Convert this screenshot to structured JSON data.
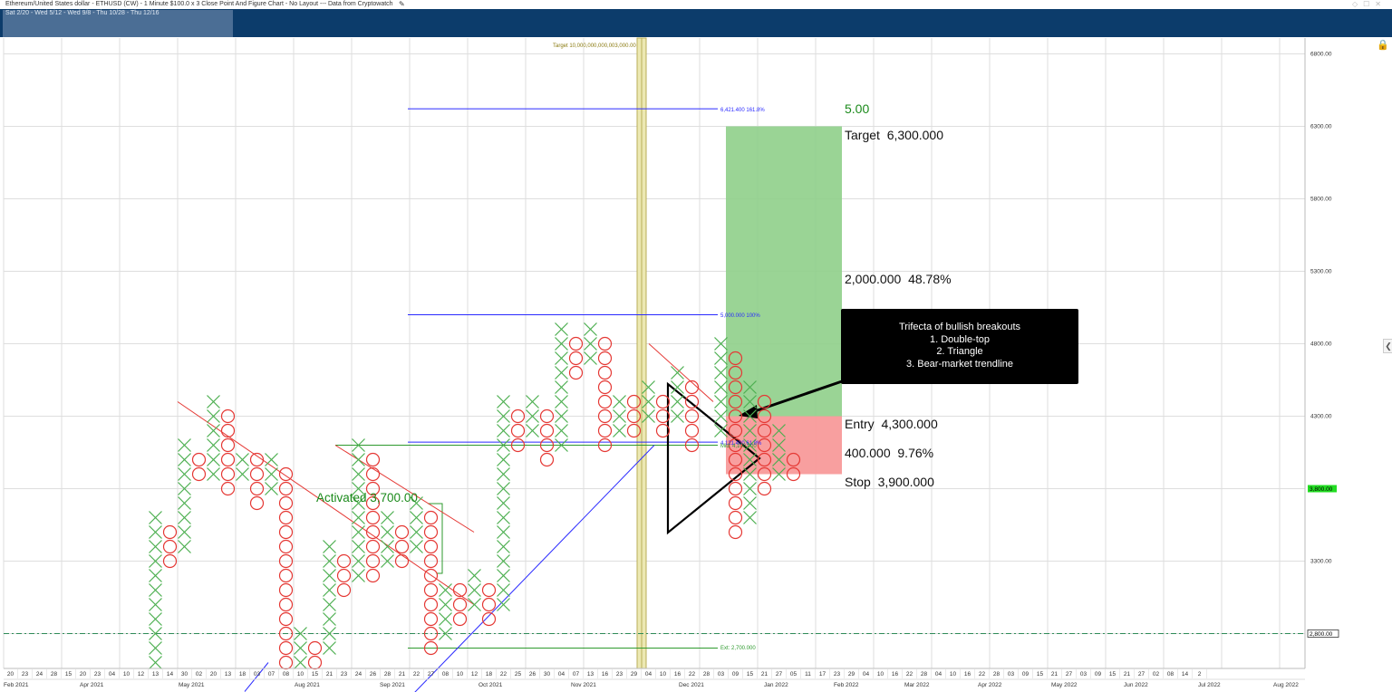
{
  "window": {
    "title": "Ethereum/United States dollar - ETHUSD (CW) - 1 Minute $100.0 x 3 Close Point And Figure Chart - No Layout --- Data from Cryptowatch",
    "navigator_label": "Sat 2/20 - Wed 5/12 - Wed 9/8 - Thu 10/28 - Thu 12/16"
  },
  "colors": {
    "x_box": "#4caf50",
    "o_box": "#e53935",
    "nav_bg": "#0c3c6b",
    "target_zone": "#8fcf8a",
    "stop_zone": "#f89a9a",
    "price_badge": "#22dd22"
  },
  "chart_data": {
    "type": "point-and-figure",
    "box_size": 100,
    "reversal": 3,
    "ylim": [
      2300,
      6900
    ],
    "y_ticks": [
      "6800.00",
      "6300.00",
      "5800.00",
      "5300.00",
      "4800.00",
      "4300.00",
      "3300.00"
    ],
    "y_tick_values": [
      6800,
      6300,
      5800,
      5300,
      4800,
      4300,
      3300
    ],
    "current_price": {
      "label": "3,800.00",
      "value": 3800
    },
    "support_line": {
      "label": "2,800.00",
      "value": 2800
    },
    "columns": [
      {
        "col": 0,
        "type": "X",
        "from": 2300,
        "to": 2300
      },
      {
        "col": 3,
        "type": "X",
        "from": 2300,
        "to": 2400
      },
      {
        "col": 4,
        "type": "O",
        "from": 2300,
        "to": 2300
      },
      {
        "col": 5,
        "type": "X",
        "from": 2300,
        "to": 3600
      },
      {
        "col": 6,
        "type": "O",
        "from": 3300,
        "to": 3500
      },
      {
        "col": 7,
        "type": "X",
        "from": 3400,
        "to": 4100
      },
      {
        "col": 8,
        "type": "O",
        "from": 3900,
        "to": 4000
      },
      {
        "col": 9,
        "type": "X",
        "from": 3900,
        "to": 4400
      },
      {
        "col": 10,
        "type": "O",
        "from": 3800,
        "to": 4300
      },
      {
        "col": 11,
        "type": "X",
        "from": 3900,
        "to": 4000
      },
      {
        "col": 12,
        "type": "O",
        "from": 3700,
        "to": 4000
      },
      {
        "col": 13,
        "type": "X",
        "from": 3800,
        "to": 4000
      },
      {
        "col": 14,
        "type": "O",
        "from": 2300,
        "to": 3900
      },
      {
        "col": 15,
        "type": "X",
        "from": 2300,
        "to": 2800
      },
      {
        "col": 16,
        "type": "O",
        "from": 2600,
        "to": 2700
      },
      {
        "col": 17,
        "type": "X",
        "from": 2700,
        "to": 3400
      },
      {
        "col": 18,
        "type": "O",
        "from": 3100,
        "to": 3300
      },
      {
        "col": 19,
        "type": "X",
        "from": 3200,
        "to": 4100
      },
      {
        "col": 20,
        "type": "O",
        "from": 3200,
        "to": 4000
      },
      {
        "col": 21,
        "type": "X",
        "from": 3300,
        "to": 3600
      },
      {
        "col": 22,
        "type": "O",
        "from": 3300,
        "to": 3500
      },
      {
        "col": 23,
        "type": "X",
        "from": 3400,
        "to": 3700
      },
      {
        "col": 24,
        "type": "O",
        "from": 2700,
        "to": 3600
      },
      {
        "col": 25,
        "type": "X",
        "from": 2800,
        "to": 3100
      },
      {
        "col": 26,
        "type": "O",
        "from": 2900,
        "to": 3100
      },
      {
        "col": 27,
        "type": "X",
        "from": 3000,
        "to": 3200
      },
      {
        "col": 28,
        "type": "O",
        "from": 2900,
        "to": 3100
      },
      {
        "col": 29,
        "type": "X",
        "from": 3000,
        "to": 4400
      },
      {
        "col": 30,
        "type": "O",
        "from": 4100,
        "to": 4300
      },
      {
        "col": 31,
        "type": "X",
        "from": 4200,
        "to": 4400
      },
      {
        "col": 32,
        "type": "O",
        "from": 4000,
        "to": 4300
      },
      {
        "col": 33,
        "type": "X",
        "from": 4100,
        "to": 4900
      },
      {
        "col": 34,
        "type": "O",
        "from": 4600,
        "to": 4800
      },
      {
        "col": 35,
        "type": "X",
        "from": 4700,
        "to": 4900
      },
      {
        "col": 36,
        "type": "O",
        "from": 4100,
        "to": 4800
      },
      {
        "col": 37,
        "type": "X",
        "from": 4200,
        "to": 4400
      },
      {
        "col": 38,
        "type": "O",
        "from": 4200,
        "to": 4400
      },
      {
        "col": 39,
        "type": "X",
        "from": 4300,
        "to": 4500
      },
      {
        "col": 40,
        "type": "O",
        "from": 4200,
        "to": 4400
      },
      {
        "col": 41,
        "type": "X",
        "from": 4300,
        "to": 4600
      },
      {
        "col": 42,
        "type": "O",
        "from": 4100,
        "to": 4500
      },
      {
        "col": 44,
        "type": "X",
        "from": 4200,
        "to": 4800
      },
      {
        "col": 45,
        "type": "O",
        "from": 3500,
        "to": 4700
      },
      {
        "col": 46,
        "type": "X",
        "from": 3600,
        "to": 4500
      },
      {
        "col": 47,
        "type": "O",
        "from": 3800,
        "to": 4400
      },
      {
        "col": 48,
        "type": "X",
        "from": 3900,
        "to": 4200
      },
      {
        "col": 49,
        "type": "O",
        "from": 3900,
        "to": 4000
      }
    ],
    "date_ticks": [
      "20",
      "23",
      "24",
      "28",
      "15",
      "20",
      "23",
      "04",
      "10",
      "12",
      "13",
      "14",
      "30",
      "02",
      "20",
      "13",
      "18",
      "03",
      "07",
      "08",
      "10",
      "15",
      "21",
      "23",
      "24",
      "26",
      "28",
      "21",
      "22",
      "27",
      "08",
      "10",
      "12",
      "18",
      "22",
      "25",
      "26",
      "30",
      "04",
      "07",
      "13",
      "16",
      "23",
      "29",
      "04",
      "10",
      "16",
      "22",
      "28",
      "03",
      "09",
      "15",
      "21",
      "27",
      "05",
      "11",
      "17",
      "23",
      "29",
      "04",
      "10",
      "16",
      "22",
      "28",
      "04",
      "10",
      "16",
      "22",
      "28",
      "03",
      "09",
      "15",
      "21",
      "27",
      "03",
      "09",
      "15",
      "21",
      "27",
      "02",
      "08",
      "14",
      "2"
    ],
    "month_labels": [
      "Feb 2021",
      "Apr 2021",
      "May 2021",
      "Aug 2021",
      "Sep 2021",
      "Oct 2021",
      "Nov 2021",
      "Dec 2021",
      "Jan 2022",
      "Feb 2022",
      "Mar 2022",
      "Apr 2022",
      "May 2022",
      "Jun 2022",
      "Jul 2022",
      "Aug 2022"
    ],
    "annotations": {
      "target_top": "Target 10,000,000,000,003,000.00",
      "fib_161": {
        "price": "6,421.400",
        "pct": "161.8%",
        "value": 6421.4
      },
      "fib_100": {
        "price": "5,000.000",
        "pct": "100%",
        "value": 5000
      },
      "fib_618": {
        "price": "4,121.400",
        "pct": "61.8%",
        "value": 4121.4
      },
      "mid": "Mid: 4,100.000",
      "ext": "Ext: 2,700.000",
      "activated": "Activated 3,700.00"
    },
    "trade": {
      "ratio": "5.00",
      "target_label": "Target",
      "target_value": "6,300.000",
      "reward": "2,000.000",
      "reward_pct": "48.78%",
      "entry_label": "Entry",
      "entry_value": "4,300.000",
      "risk": "400.000",
      "risk_pct": "9.76%",
      "stop_label": "Stop",
      "stop_value": "3,900.000"
    },
    "callout": {
      "title": "Trifecta of bullish breakouts",
      "items": [
        "1. Double-top",
        "2. Triangle",
        "3. Bear-market trendline"
      ]
    }
  }
}
